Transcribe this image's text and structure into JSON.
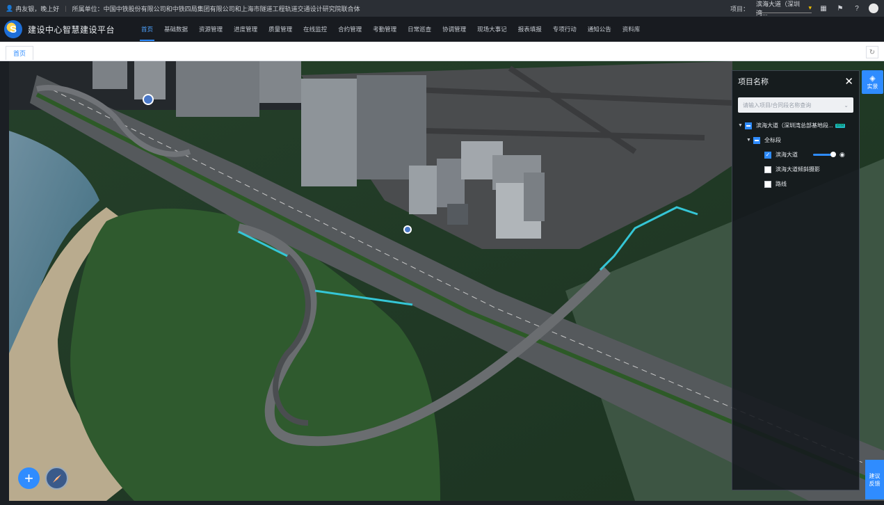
{
  "topbar": {
    "user_greeting": "冉友银，晚上好",
    "unit_label": "所属单位：",
    "unit_value": "中国中铁股份有限公司和中铁四局集团有限公司和上海市隧道工程轨道交通设计研究院联合体",
    "project_label": "项目：",
    "project_value": "滨海大道（深圳湾...",
    "icons": [
      "calendar-icon",
      "flag-icon",
      "help-icon"
    ]
  },
  "navbar": {
    "brand": "建设中心智慧建设平台",
    "logo_letter": "S",
    "menu": [
      {
        "label": "首页",
        "active": true
      },
      {
        "label": "基础数据",
        "active": false
      },
      {
        "label": "资源管理",
        "active": false
      },
      {
        "label": "进度管理",
        "active": false
      },
      {
        "label": "质量管理",
        "active": false
      },
      {
        "label": "在线监控",
        "active": false
      },
      {
        "label": "合约管理",
        "active": false
      },
      {
        "label": "考勤管理",
        "active": false
      },
      {
        "label": "日常巡查",
        "active": false
      },
      {
        "label": "协调管理",
        "active": false
      },
      {
        "label": "现场大事记",
        "active": false
      },
      {
        "label": "报表填报",
        "active": false
      },
      {
        "label": "专项行动",
        "active": false
      },
      {
        "label": "通知公告",
        "active": false
      },
      {
        "label": "资料库",
        "active": false
      }
    ]
  },
  "tabs": {
    "home": "首页",
    "refresh_icon": "↻"
  },
  "panel": {
    "title": "项目名称",
    "close": "✕",
    "search_placeholder": "请输入项目/合同段名称查询",
    "tree": {
      "root": "滨海大道（深圳湾总部基地段...",
      "root_badge": "BIM",
      "section": "全标段",
      "layers": [
        {
          "label": "滨海大道",
          "checked": true
        },
        {
          "label": "滨海大道倾斜摄影",
          "checked": false
        },
        {
          "label": "路线",
          "checked": false
        }
      ]
    }
  },
  "layer_button": {
    "label": "实景"
  },
  "feedback_button": {
    "label": "建议反馈"
  },
  "zoom": {
    "plus": "+"
  },
  "colors": {
    "accent": "#2f8cff",
    "route": "#35c6d6",
    "topbar": "#2b2f35",
    "navbar": "#181b20"
  }
}
